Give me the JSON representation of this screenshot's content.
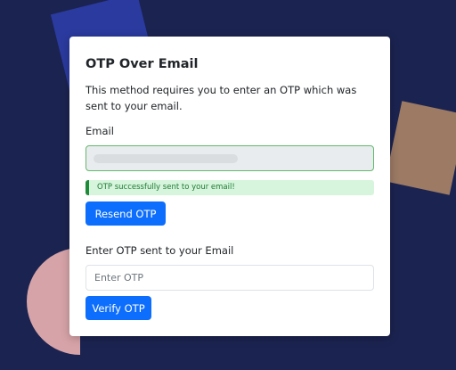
{
  "colors": {
    "background": "#1b2350",
    "primary_button": "#0d6efd",
    "success_border": "#1f8a3a",
    "success_bg": "#d6f5dc",
    "email_field_border": "#62b96c"
  },
  "card": {
    "title": "OTP Over Email",
    "description": "This method requires you to enter an OTP which was sent to your email.",
    "email_label": "Email",
    "email_value": "",
    "alert_text": "OTP successfully sent to your email!",
    "resend_label": "Resend OTP",
    "otp_label": "Enter OTP sent to your Email",
    "otp_placeholder": "Enter OTP",
    "verify_label": "Verify OTP"
  }
}
